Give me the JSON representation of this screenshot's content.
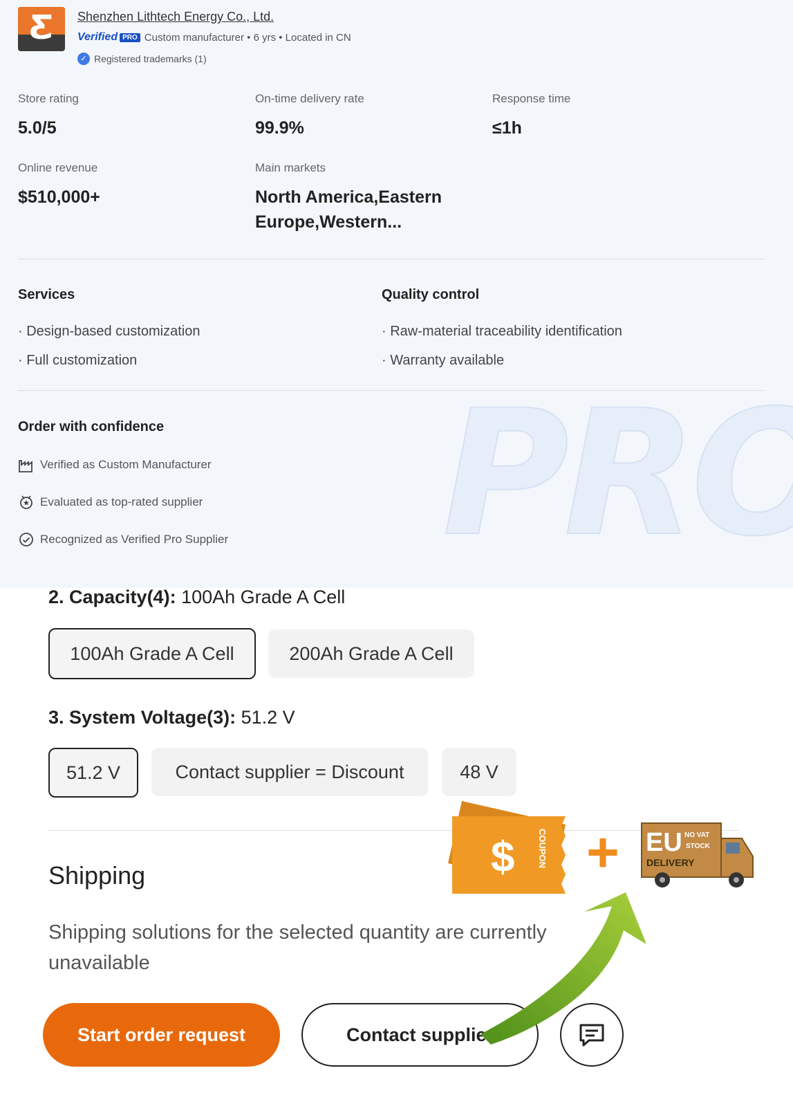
{
  "supplier": {
    "name": "Shenzhen Lithtech Energy Co., Ltd.",
    "verified_word": "Verified",
    "pro_badge": "PRO",
    "meta": "Custom manufacturer • 6 yrs • Located in CN",
    "trademarks": "Registered trademarks (1)"
  },
  "stats": {
    "store_rating": {
      "label": "Store rating",
      "value": "5.0/5"
    },
    "on_time": {
      "label": "On-time delivery rate",
      "value": "99.9%"
    },
    "response": {
      "label": "Response time",
      "value": "≤1h"
    },
    "revenue": {
      "label": "Online revenue",
      "value": "$510,000+"
    },
    "markets": {
      "label": "Main markets",
      "value": "North America,Eastern Europe,Western..."
    }
  },
  "services": {
    "title": "Services",
    "items": [
      "· Design-based customization",
      "· Full customization"
    ]
  },
  "quality": {
    "title": "Quality control",
    "items": [
      "· Raw-material traceability identification",
      "· Warranty available"
    ]
  },
  "confidence": {
    "title": "Order with confidence",
    "items": [
      "Verified as Custom Manufacturer",
      "Evaluated as top-rated supplier",
      "Recognized as Verified Pro Supplier"
    ]
  },
  "watermark": "PRO",
  "capacity": {
    "label": "2. Capacity(4):",
    "selected": "100Ah Grade A Cell",
    "options": [
      "100Ah Grade A Cell",
      "200Ah Grade A Cell"
    ]
  },
  "voltage": {
    "label": "3. System Voltage(3):",
    "selected": "51.2 V",
    "options": [
      "51.2 V",
      "Contact supplier = Discount",
      "48 V"
    ]
  },
  "shipping": {
    "title": "Shipping",
    "text": "Shipping solutions for the selected quantity are currently unavailable"
  },
  "actions": {
    "order": "Start order request",
    "contact": "Contact supplier"
  },
  "promo": {
    "coupon_symbol": "$",
    "coupon_text": "COUPON",
    "plus": "+",
    "eu": "EU",
    "no_vat": "NO VAT",
    "stock": "STOCK",
    "delivery": "DELIVERY"
  },
  "colors": {
    "accent": "#e8690c",
    "verified_blue": "#1a4fc4",
    "top_bg": "#f3f7fc"
  }
}
